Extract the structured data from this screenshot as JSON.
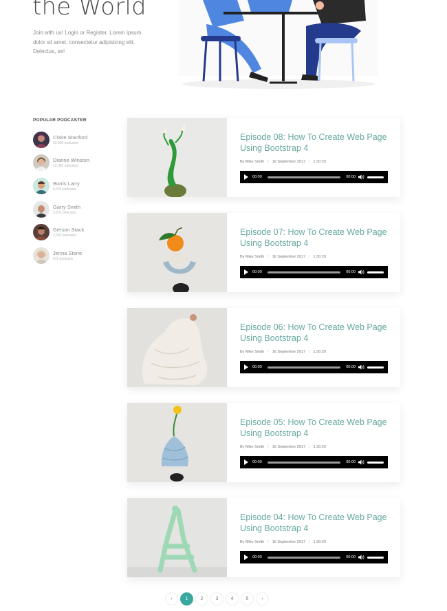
{
  "hero": {
    "title": "the World",
    "text": "Join with us! Login or Register. Lorem ipsum dolor sit amet, consectetur adipisicing elit. Delectus, ex!"
  },
  "sidebar": {
    "title": "POPULAR PODCASTER",
    "podcasters": [
      {
        "name": "Claire Stanford",
        "count": "22,000 podcasts"
      },
      {
        "name": "Dianne Winston",
        "count": "12,081 podcasts"
      },
      {
        "name": "Borris Larry",
        "count": "8,291 podcasts"
      },
      {
        "name": "Garry Smith",
        "count": "3,291 podcasts"
      },
      {
        "name": "Gerson Stack",
        "count": "1,002 podcasts"
      },
      {
        "name": "Jenna Stone",
        "count": "911 podcasts"
      }
    ]
  },
  "episodes": [
    {
      "title": "Episode 08: How To Create Web Page Using Bootstrap 4",
      "author": "By Mike Smith",
      "date": "16 September 2017",
      "duration": "1:30:20",
      "time_start": "00:00",
      "time_end": "00:00"
    },
    {
      "title": "Episode 07: How To Create Web Page Using Bootstrap 4",
      "author": "By Mike Smith",
      "date": "16 September 2017",
      "duration": "1:30:20",
      "time_start": "00:00",
      "time_end": "00:00"
    },
    {
      "title": "Episode 06: How To Create Web Page Using Bootstrap 4",
      "author": "By Mike Smith",
      "date": "16 September 2017",
      "duration": "1:30:20",
      "time_start": "00:00",
      "time_end": "00:00"
    },
    {
      "title": "Episode 05: How To Create Web Page Using Bootstrap 4",
      "author": "By Mike Smith",
      "date": "16 September 2017",
      "duration": "1:30:20",
      "time_start": "00:00",
      "time_end": "00:00"
    },
    {
      "title": "Episode 04: How To Create Web Page Using Bootstrap 4",
      "author": "By Mike Smith",
      "date": "16 September 2017",
      "duration": "1:30:20",
      "time_start": "00:00",
      "time_end": "00:00"
    }
  ],
  "pagination": {
    "prev": "‹",
    "pages": [
      "1",
      "2",
      "3",
      "4",
      "5"
    ],
    "next": "›",
    "active": "1"
  },
  "colors": {
    "accent": "#3aa89f",
    "title": "#66a8a0"
  }
}
